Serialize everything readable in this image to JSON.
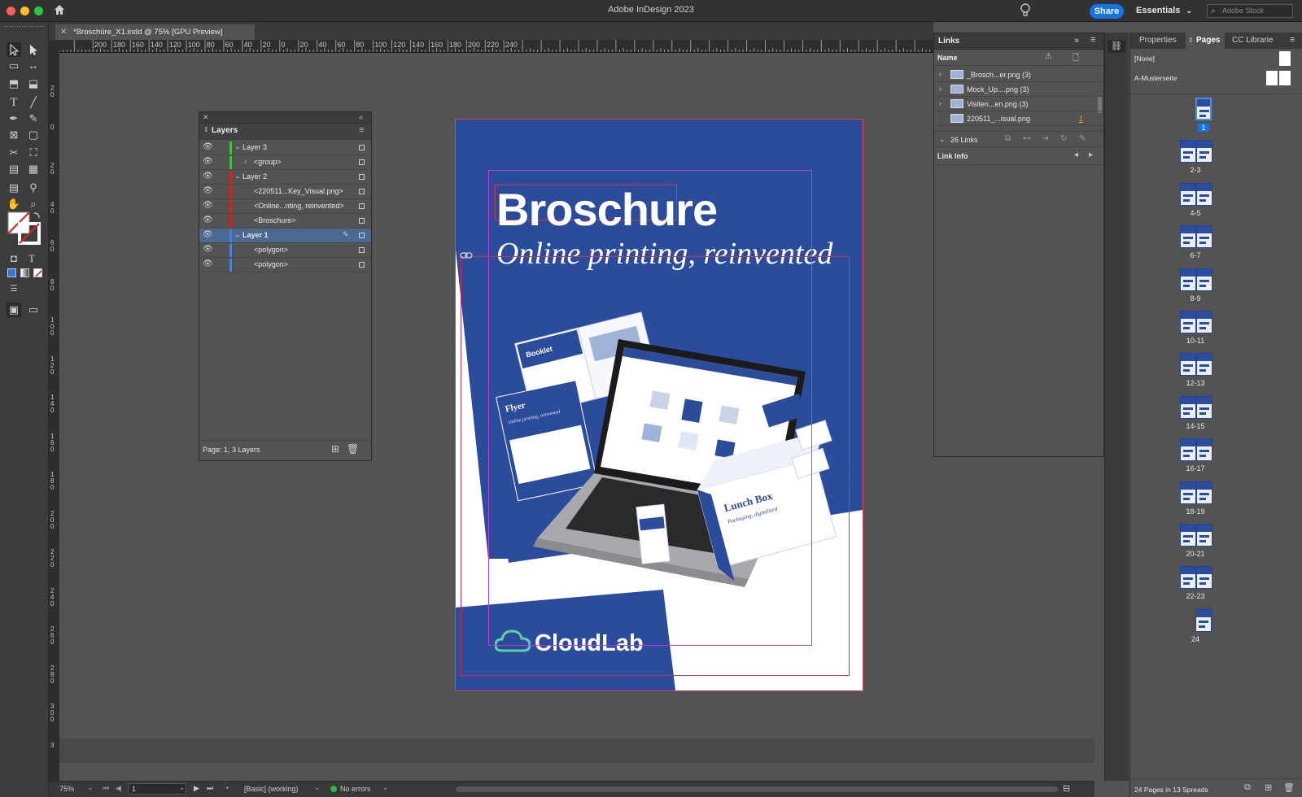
{
  "app": {
    "title": "Adobe InDesign 2023",
    "share_label": "Share",
    "workspace_label": "Essentials",
    "stock_placeholder": "Adobe Stock"
  },
  "document": {
    "tab_label": "*Broschüre_X1.indd @ 75% [GPU Preview]",
    "title_text": "Broschure",
    "subtitle_text": "Online printing, reinvented",
    "brand_text": "CloudLab",
    "mockup_labels": {
      "booklet": "Booklet",
      "flyer": "Flyer",
      "flyer_sub": "Online printing, reinvented",
      "lunchbox": "Lunch Box",
      "lunchbox_sub": "Packaging, digitalized"
    },
    "accent_blue": "#2b4b9b"
  },
  "rulers": {
    "horizontal_ticks": [
      "200",
      "180",
      "160",
      "140",
      "120",
      "100",
      "80",
      "60",
      "40",
      "20",
      "0",
      "20",
      "40",
      "60",
      "80",
      "100",
      "120",
      "140",
      "160",
      "180",
      "200",
      "220",
      "240"
    ],
    "vertical_ticks": [
      "2 0",
      "0",
      "2 0",
      "4 0",
      "6 0",
      "8 0",
      "1 0 0",
      "1 2 0",
      "1 4 0",
      "1 6 0",
      "1 8 0",
      "2 0 0",
      "2 2 0",
      "2 4 0",
      "2 6 0",
      "2 8 0",
      "3 0 0",
      "3"
    ]
  },
  "layers_panel": {
    "title": "Layers",
    "rows": [
      {
        "label": "Layer 3",
        "color": "#3fc23f"
      },
      {
        "label": "<group>",
        "color": "#3fc23f"
      },
      {
        "label": "Layer 2",
        "color": "#d02424"
      },
      {
        "label": "<220511...Key_Visual.png>",
        "color": "#d02424"
      },
      {
        "label": "<Online...nting, reinvented>",
        "color": "#d02424"
      },
      {
        "label": "<Broschure>",
        "color": "#d02424"
      },
      {
        "label": "Layer 1",
        "color": "#4c7fd8"
      },
      {
        "label": "<polygon>",
        "color": "#4c7fd8"
      },
      {
        "label": "<polygon>",
        "color": "#4c7fd8"
      }
    ],
    "footer": "Page: 1, 3 Layers"
  },
  "links_panel": {
    "title": "Links",
    "column_name": "Name",
    "rows": [
      {
        "label": "_Brosch...er.png (3)",
        "badge": ""
      },
      {
        "label": "Mock_Up....png (3)",
        "badge": ""
      },
      {
        "label": "Visiten...en.png (3)",
        "badge": ""
      },
      {
        "label": "220511_...isual.png",
        "badge": "1"
      }
    ],
    "count_label": "26 Links",
    "link_info_label": "Link Info"
  },
  "pages_panel": {
    "tabs": [
      "Properties",
      "Pages",
      "CC Librarie"
    ],
    "masters": [
      "[None]",
      "A-Musterseite"
    ],
    "spreads": [
      "1",
      "2-3",
      "4-5",
      "6-7",
      "8-9",
      "10-11",
      "12-13",
      "14-15",
      "16-17",
      "18-19",
      "20-21",
      "22-23",
      "24"
    ],
    "footer": "24 Pages in 13 Spreads"
  },
  "status": {
    "zoom": "75%",
    "page": "1",
    "preflight_profile": "[Basic] (working)",
    "errors": "No errors"
  }
}
